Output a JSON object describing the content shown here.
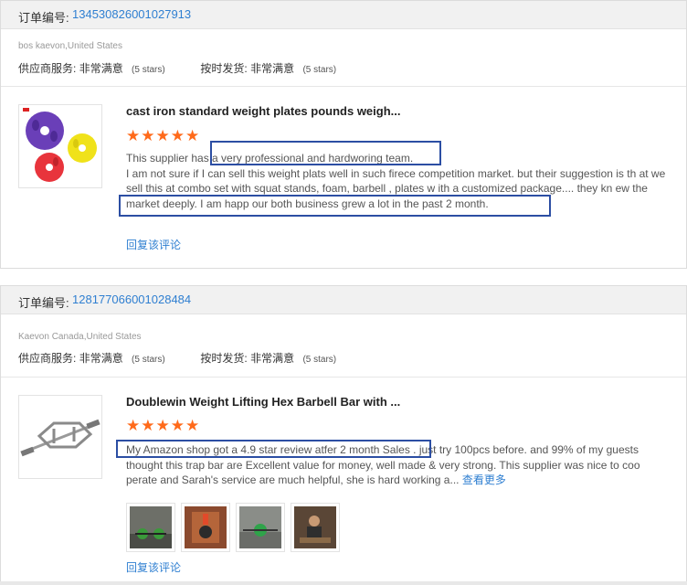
{
  "orders": [
    {
      "order_label": "订单编号:",
      "order_number": "134530826001027913",
      "buyer": "bos kaevon,United States",
      "service_label": "供应商服务:",
      "service_value": "非常满意",
      "service_stars": "(5 stars)",
      "shipping_label": "按时发货:",
      "shipping_value": "非常满意",
      "shipping_stars": "(5 stars)",
      "product_image": "weight-plates-image",
      "product_title": "cast iron standard weight plates pounds weigh...",
      "rating": 5,
      "review_text": "This supplier has a very professional and hardworing team.\nI am not sure if I can sell this weight plats well in such firece competition market. but their suggestion is th at we sell this at combo set with squat stands, foam, barbell , plates w ith a customized package.... they kn ew the market deeply. I am happ our both business grew a lot in the past 2 month.",
      "reply_link": "回复该评论"
    },
    {
      "order_label": "订单编号:",
      "order_number": "128177066001028484",
      "buyer": "Kaevon Canada,United States",
      "service_label": "供应商服务:",
      "service_value": "非常满意",
      "service_stars": "(5 stars)",
      "shipping_label": "按时发货:",
      "shipping_value": "非常满意",
      "shipping_stars": "(5 stars)",
      "product_image": "hex-barbell-image",
      "product_title": "Doublewin Weight Lifting Hex Barbell Bar with ...",
      "rating": 5,
      "review_text": "My Amazon  shop got a 4.9 star review atfer 2 month Sales . just try 100pcs before. and 99% of my guests thought this trap bar are  Excellent value for money, well made & very strong. This supplier was nice to coo perate and Sarah's service are much helpful, she is hard working a...",
      "see_more": "查看更多",
      "review_photos": [
        "gym-photo-1",
        "gym-photo-2",
        "gym-photo-3",
        "gym-photo-4"
      ],
      "reply_link": "回复该评论"
    }
  ],
  "colors": {
    "link": "#2f7fd1",
    "star": "#ff6a1a",
    "highlight_box": "#2c4ea3",
    "header_bg": "#f1f1f1"
  }
}
